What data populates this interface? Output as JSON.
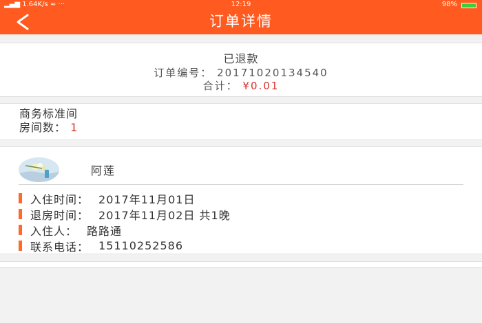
{
  "status_bar": {
    "left": "▂▄▆ 1.64K/s ≈ ···",
    "time": "12:19",
    "battery": "98%"
  },
  "header": {
    "back_icon": "chevron-left-icon",
    "title": "订单详情"
  },
  "order": {
    "status": "已退款",
    "number_label": "订单编号：",
    "number": "20171020134540",
    "total_label": "合计：",
    "total": "¥0.01"
  },
  "room": {
    "type": "商务标准间",
    "count_label": "房间数：",
    "count": "1"
  },
  "guest": {
    "name": "阿莲",
    "details": [
      {
        "label": "入住时间：",
        "value": "2017年11月01日"
      },
      {
        "label": "退房时间：",
        "value": "2017年11月02日    共1晚"
      },
      {
        "label": "入住人：",
        "value": "路路通"
      },
      {
        "label": "联系电话：",
        "value": "15110252586"
      }
    ]
  },
  "colors": {
    "accent": "#ff5a1f",
    "price": "#d9322b",
    "marker": "#ff6a2a"
  }
}
